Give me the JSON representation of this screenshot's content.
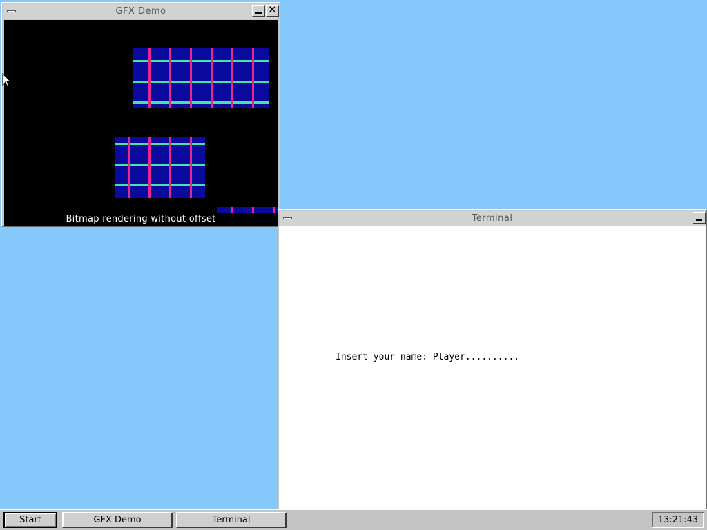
{
  "colors": {
    "desktop": "#85c8fb",
    "grid_fill": "#0a0a9e",
    "grid_h_line": "#46e6a0",
    "grid_v_line": "#e6288c",
    "canvas_bg": "#000000"
  },
  "gfx_window": {
    "title": "GFX Demo",
    "caption": "Bitmap rendering without offset",
    "icons": [
      "window-menu-icon",
      "minimize-icon",
      "close-icon"
    ],
    "close_glyph": "✕"
  },
  "terminal_window": {
    "title": "Terminal",
    "prompt_line": "Insert your name: Player..........",
    "icons": [
      "window-menu-icon",
      "minimize-icon"
    ]
  },
  "taskbar": {
    "start_label": "Start",
    "tasks": [
      {
        "label": "GFX Demo"
      },
      {
        "label": "Terminal"
      }
    ],
    "clock": "13:21:43"
  }
}
